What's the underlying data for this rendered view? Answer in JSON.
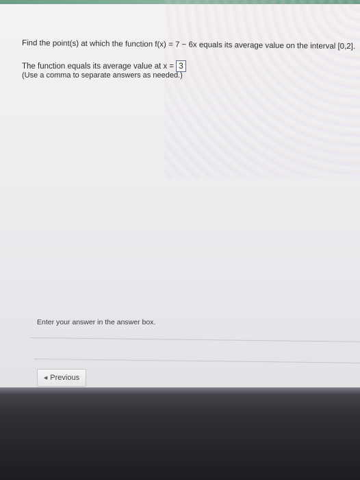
{
  "question": {
    "text": "Find the point(s) at which the function f(x) = 7 − 6x equals its average value on the interval [0,2]."
  },
  "answer": {
    "prefix": "The function equals its average value at x =",
    "value": "3",
    "hint": "(Use a comma to separate answers as needed.)"
  },
  "footer": {
    "instruction": "Enter your answer in the answer box.",
    "previous_label": "Previous"
  },
  "icons": {
    "previous": "triangle-left-icon"
  },
  "colors": {
    "top_bar": "#6a9e84",
    "answer_border": "#5e6b80"
  }
}
